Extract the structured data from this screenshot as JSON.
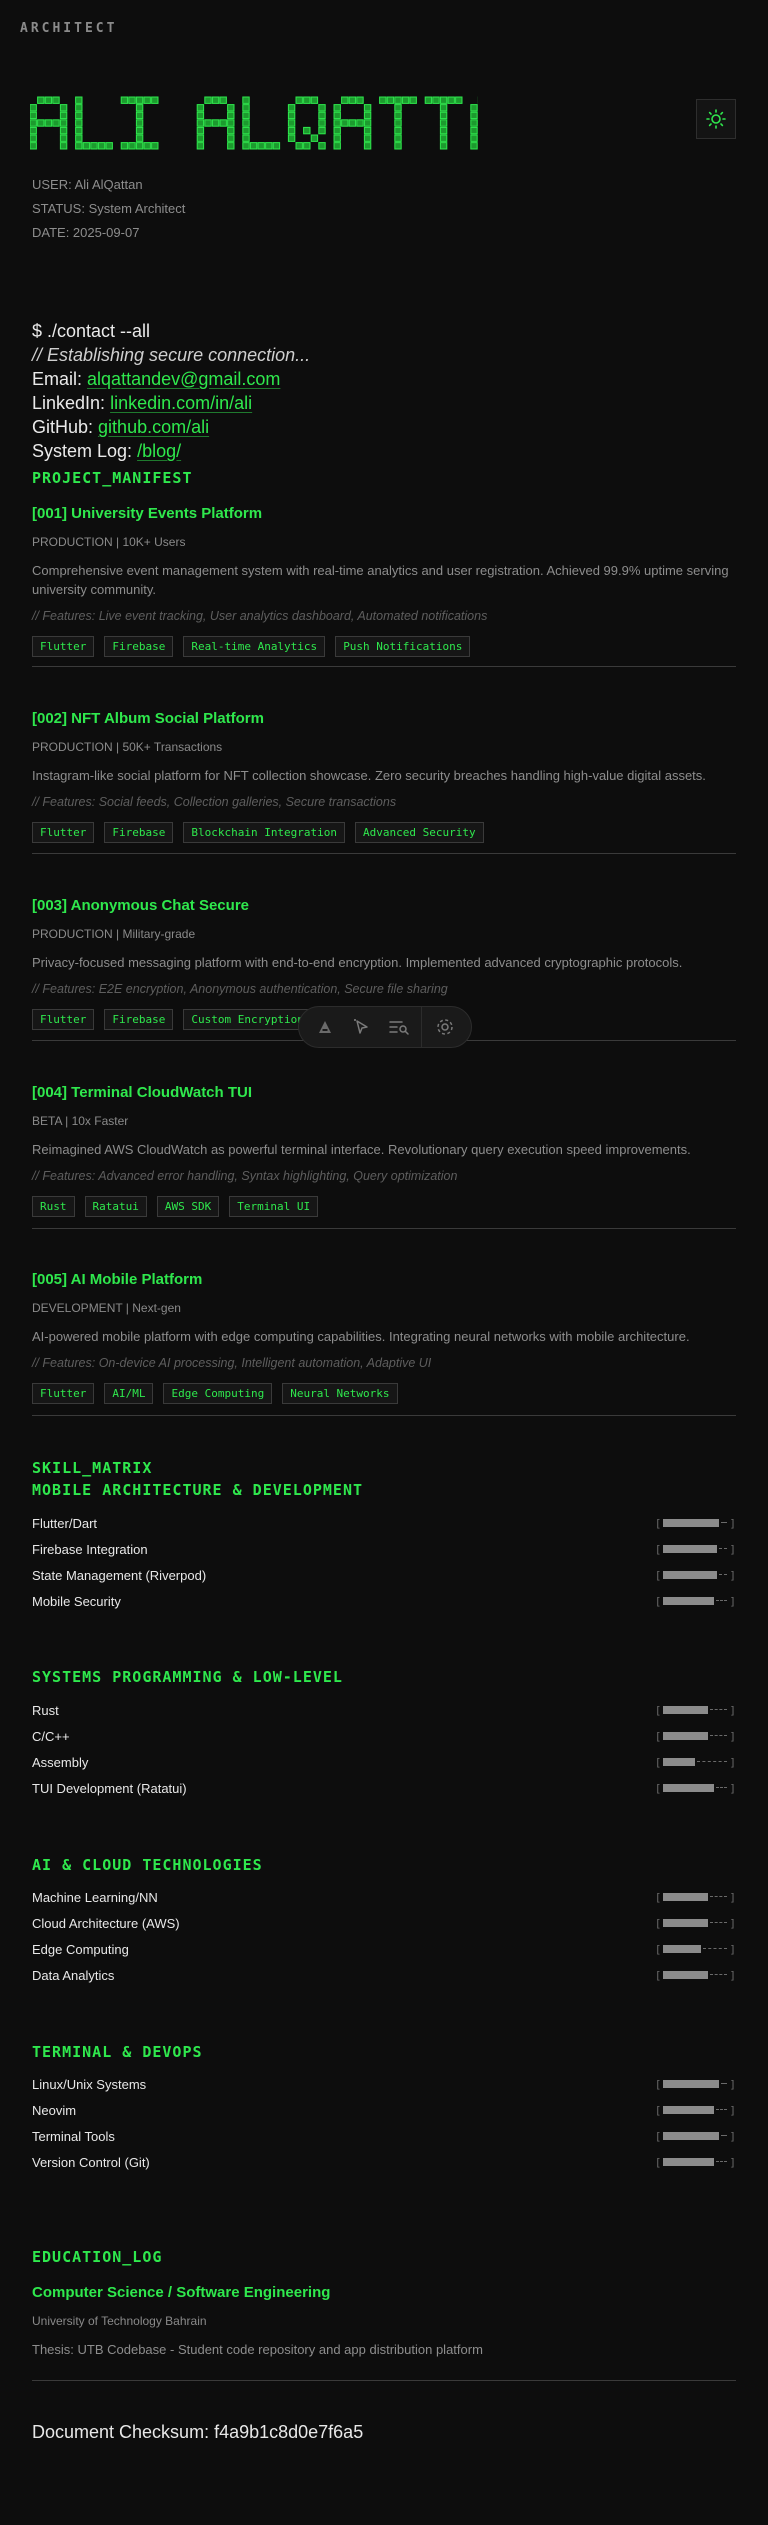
{
  "header": {
    "brand": "ARCHITECT",
    "banner_text": "ALI ALQATTAN"
  },
  "meta": {
    "user": "USER: Ali AlQattan",
    "status": "STATUS: System Architect",
    "date": "DATE: 2025-09-07"
  },
  "contact": {
    "command": "$ ./contact --all",
    "comment": "// Establishing secure connection...",
    "email_label": "Email:",
    "email_value": "alqattandev@gmail.com",
    "linkedin_label": "LinkedIn:",
    "linkedin_value": "linkedin.com/in/ali",
    "github_label": "GitHub:",
    "github_value": "github.com/ali",
    "log_label": "System Log:",
    "log_value": "/blog/"
  },
  "projects_heading": "PROJECT_MANIFEST",
  "projects": [
    {
      "title": "[001] University Events Platform",
      "meta": "PRODUCTION | 10K+ Users",
      "desc": "Comprehensive event management system with real-time analytics and user registration. Achieved 99.9% uptime serving university community.",
      "features": "// Features: Live event tracking, User analytics dashboard, Automated notifications",
      "tags": [
        "Flutter",
        "Firebase",
        "Real-time Analytics",
        "Push Notifications"
      ]
    },
    {
      "title": "[002] NFT Album Social Platform",
      "meta": "PRODUCTION | 50K+ Transactions",
      "desc": "Instagram-like social platform for NFT collection showcase. Zero security breaches handling high-value digital assets.",
      "features": "// Features: Social feeds, Collection galleries, Secure transactions",
      "tags": [
        "Flutter",
        "Firebase",
        "Blockchain Integration",
        "Advanced Security"
      ]
    },
    {
      "title": "[003] Anonymous Chat Secure",
      "meta": "PRODUCTION | Military-grade",
      "desc": "Privacy-focused messaging platform with end-to-end encryption. Implemented advanced cryptographic protocols.",
      "features": "// Features: E2E encryption, Anonymous authentication, Secure file sharing",
      "tags": [
        "Flutter",
        "Firebase",
        "Custom Encryption"
      ]
    },
    {
      "title": "[004] Terminal CloudWatch TUI",
      "meta": "BETA | 10x Faster",
      "desc": "Reimagined AWS CloudWatch as powerful terminal interface. Revolutionary query execution speed improvements.",
      "features": "// Features: Advanced error handling, Syntax highlighting, Query optimization",
      "tags": [
        "Rust",
        "Ratatui",
        "AWS SDK",
        "Terminal UI"
      ]
    },
    {
      "title": "[005] AI Mobile Platform",
      "meta": "DEVELOPMENT | Next-gen",
      "desc": "AI-powered mobile platform with edge computing capabilities. Integrating neural networks with mobile architecture.",
      "features": "// Features: On-device AI processing, Intelligent automation, Adaptive UI",
      "tags": [
        "Flutter",
        "AI/ML",
        "Edge Computing",
        "Neural Networks"
      ]
    }
  ],
  "skills_heading": "SKILL_MATRIX",
  "skill_groups": [
    {
      "title": "MOBILE ARCHITECTURE & DEVELOPMENT",
      "skills": [
        {
          "name": "Flutter/Dart",
          "level": 0.9
        },
        {
          "name": "Firebase Integration",
          "level": 0.85
        },
        {
          "name": "State Management (Riverpod)",
          "level": 0.85
        },
        {
          "name": "Mobile Security",
          "level": 0.8
        }
      ]
    },
    {
      "title": "SYSTEMS PROGRAMMING & LOW-LEVEL",
      "skills": [
        {
          "name": "Rust",
          "level": 0.7
        },
        {
          "name": "C/C++",
          "level": 0.7
        },
        {
          "name": "Assembly",
          "level": 0.5
        },
        {
          "name": "TUI Development (Ratatui)",
          "level": 0.8
        }
      ]
    },
    {
      "title": "AI & CLOUD TECHNOLOGIES",
      "skills": [
        {
          "name": "Machine Learning/NN",
          "level": 0.7
        },
        {
          "name": "Cloud Architecture (AWS)",
          "level": 0.7
        },
        {
          "name": "Edge Computing",
          "level": 0.6
        },
        {
          "name": "Data Analytics",
          "level": 0.7
        }
      ]
    },
    {
      "title": "TERMINAL & DEVOPS",
      "skills": [
        {
          "name": "Linux/Unix Systems",
          "level": 0.9
        },
        {
          "name": "Neovim",
          "level": 0.8
        },
        {
          "name": "Terminal Tools",
          "level": 0.9
        },
        {
          "name": "Version Control (Git)",
          "level": 0.8
        }
      ]
    }
  ],
  "education_heading": "EDUCATION_LOG",
  "education": {
    "degree": "Computer Science / Software Engineering",
    "school": "University of Technology Bahrain",
    "thesis": "Thesis: UTB Codebase - Student code repository and app distribution platform"
  },
  "checksum": "Document Checksum: f4a9b1c8d0e7f6a5",
  "colors": {
    "accent": "#2fe84d",
    "background": "#0d0d0d",
    "muted": "#8d8d8d"
  },
  "icons": {
    "theme": "sun-icon",
    "toolbar": [
      "logo-a-icon",
      "cursor-sparkle-icon",
      "list-search-icon",
      "gear-icon"
    ]
  }
}
